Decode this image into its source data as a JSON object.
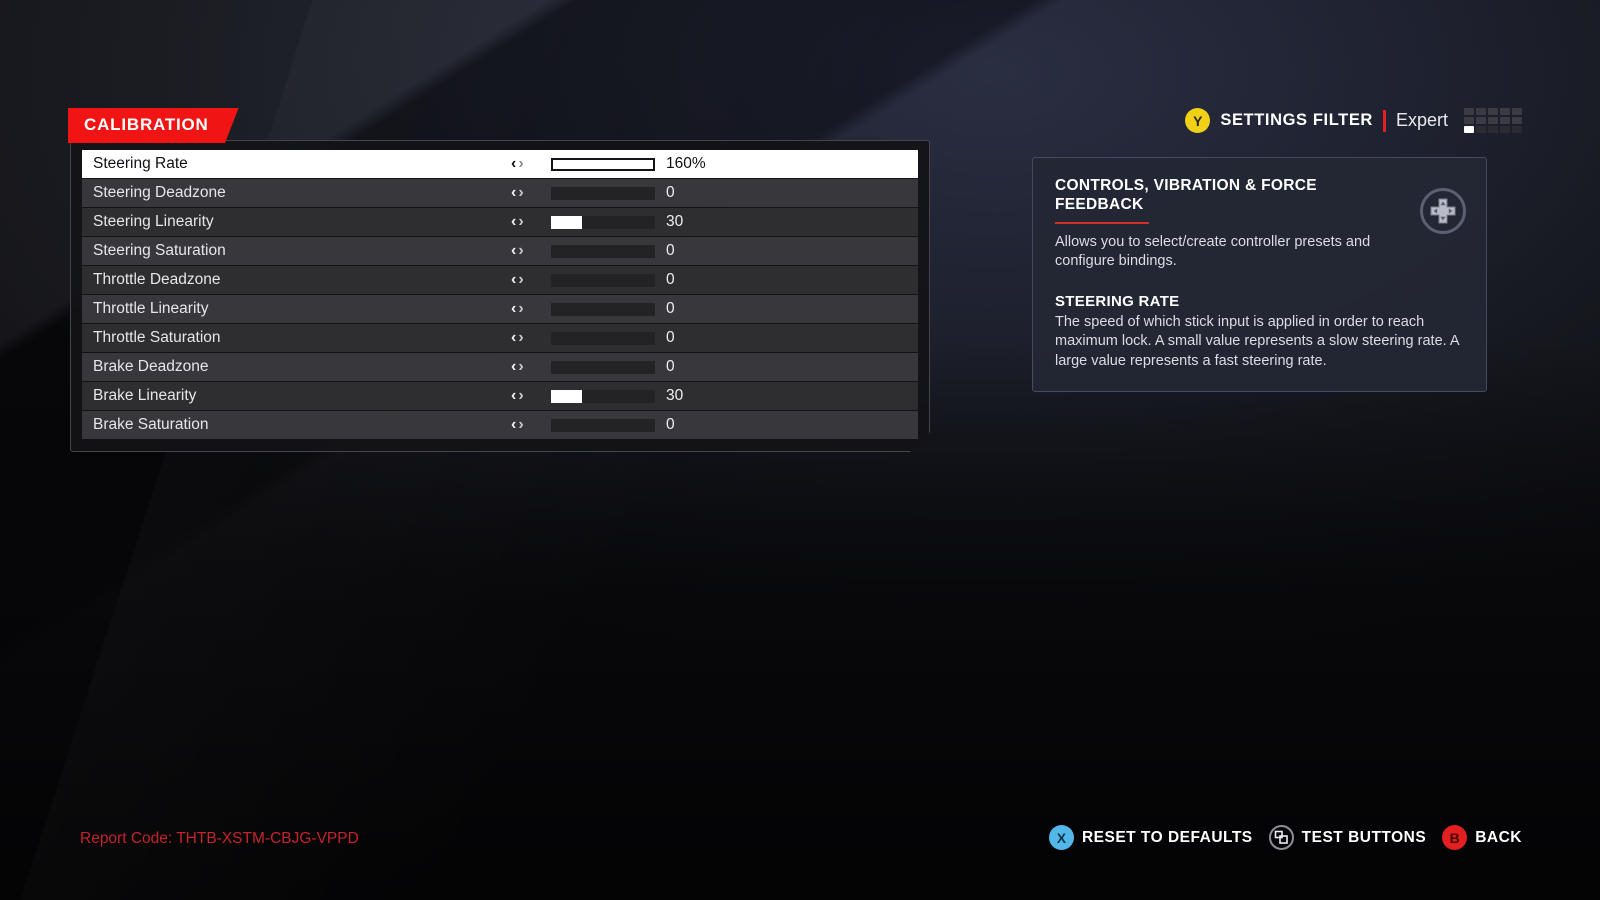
{
  "tab": {
    "label": "CALIBRATION"
  },
  "filter": {
    "button_glyph": "Y",
    "label": "SETTINGS FILTER",
    "value": "Expert",
    "level_cells_total": 15,
    "level_active_index": 10
  },
  "settings": {
    "rows": [
      {
        "label": "Steering Rate",
        "value": "160%",
        "fill_percent": 100,
        "selected": true
      },
      {
        "label": "Steering Deadzone",
        "value": "0",
        "fill_percent": 0,
        "selected": false
      },
      {
        "label": "Steering Linearity",
        "value": "30",
        "fill_percent": 30,
        "selected": false
      },
      {
        "label": "Steering Saturation",
        "value": "0",
        "fill_percent": 0,
        "selected": false
      },
      {
        "label": "Throttle Deadzone",
        "value": "0",
        "fill_percent": 0,
        "selected": false
      },
      {
        "label": "Throttle Linearity",
        "value": "0",
        "fill_percent": 0,
        "selected": false
      },
      {
        "label": "Throttle Saturation",
        "value": "0",
        "fill_percent": 0,
        "selected": false
      },
      {
        "label": "Brake Deadzone",
        "value": "0",
        "fill_percent": 0,
        "selected": false
      },
      {
        "label": "Brake Linearity",
        "value": "30",
        "fill_percent": 30,
        "selected": false
      },
      {
        "label": "Brake Saturation",
        "value": "0",
        "fill_percent": 0,
        "selected": false
      }
    ],
    "arrow_left": "‹",
    "arrow_right": "›"
  },
  "info": {
    "title": "CONTROLS, VIBRATION & FORCE FEEDBACK",
    "text": "Allows you to select/create controller presets and configure bindings.",
    "sub_title": "STEERING RATE",
    "sub_text": "The speed of which stick input is applied in order to reach maximum lock. A small value represents a slow steering rate. A large value represents a fast steering rate."
  },
  "footer": {
    "report_code": "Report Code: THTB-XSTM-CBJG-VPPD",
    "prompts": [
      {
        "glyph": "X",
        "label": "RESET TO DEFAULTS",
        "style": "x"
      },
      {
        "glyph": "",
        "label": "TEST BUTTONS",
        "style": "view"
      },
      {
        "glyph": "B",
        "label": "BACK",
        "style": "b"
      }
    ]
  },
  "colors": {
    "accent_red": "#f01414",
    "button_y": "#f0d117",
    "button_x": "#52b6e8",
    "button_b": "#e31f1f",
    "report_red": "#c4242b"
  }
}
